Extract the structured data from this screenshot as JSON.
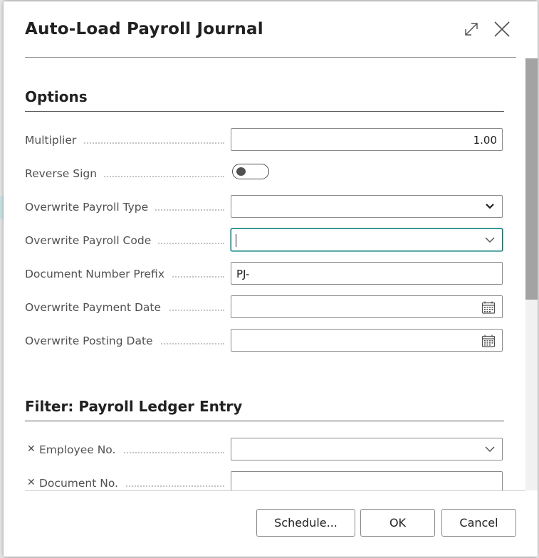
{
  "dialog": {
    "title": "Auto-Load Payroll Journal",
    "icons": {
      "expand": "expand-icon",
      "close": "close-icon"
    }
  },
  "options": {
    "title": "Options",
    "fields": {
      "multiplier": {
        "label": "Multiplier",
        "value": "1.00"
      },
      "reverse_sign": {
        "label": "Reverse Sign",
        "value": false
      },
      "overwrite_payroll_type": {
        "label": "Overwrite Payroll Type",
        "value": ""
      },
      "overwrite_payroll_code": {
        "label": "Overwrite Payroll Code",
        "value": ""
      },
      "document_number_prefix": {
        "label": "Document Number Prefix",
        "value": "PJ-"
      },
      "overwrite_payment_date": {
        "label": "Overwrite Payment Date",
        "value": ""
      },
      "overwrite_posting_date": {
        "label": "Overwrite Posting Date",
        "value": ""
      }
    }
  },
  "filter": {
    "title": "Filter: Payroll Ledger Entry",
    "fields": {
      "employee_no": {
        "label": "Employee No.",
        "value": ""
      },
      "document_no": {
        "label": "Document No.",
        "value": ""
      }
    }
  },
  "footer": {
    "schedule_label": "Schedule...",
    "ok_label": "OK",
    "cancel_label": "Cancel"
  },
  "colors": {
    "accent": "#00787a",
    "scrollbar_thumb": "#a3a3a3"
  }
}
